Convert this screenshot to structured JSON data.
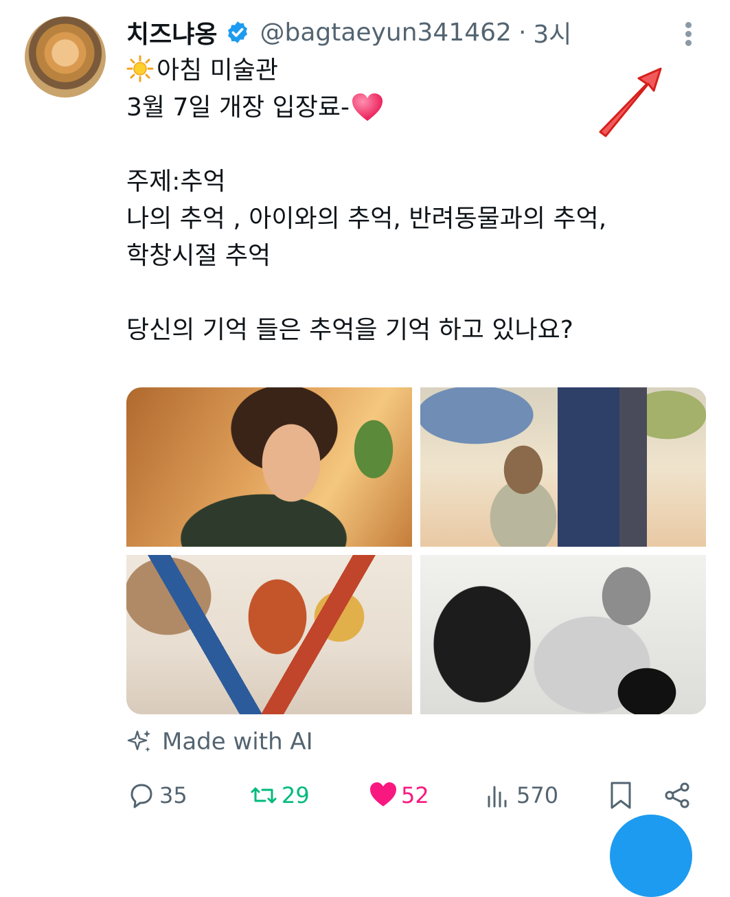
{
  "tweet": {
    "author_name": "치즈냐옹",
    "handle": "@bagtaeyun341462",
    "separator": "·",
    "time": "3시",
    "lines": [
      "아침 미술관",
      "3월 7일 개장 입장료-",
      "",
      "주제:추억",
      "나의 추억 , 아이와의 추억, 반려동물과의 추억,",
      "학창시절 추억",
      "",
      "당신의 기억 들은 추억을 기억 하고 있나요?"
    ],
    "images": [
      {
        "name": "woman-portrait-watercolor"
      },
      {
        "name": "child-holding-hand-watercolor"
      },
      {
        "name": "playground-children-watercolor"
      },
      {
        "name": "dog-cat-person-ink"
      }
    ],
    "ai_label": "Made with AI"
  },
  "actions": {
    "replies": "35",
    "reposts": "29",
    "likes": "52",
    "views": "570"
  },
  "colors": {
    "text": "#0f1419",
    "secondary": "#536471",
    "verified": "#1d9bf0",
    "repost": "#00ba7c",
    "like": "#f91880",
    "annotation_arrow": "#e8302b"
  }
}
